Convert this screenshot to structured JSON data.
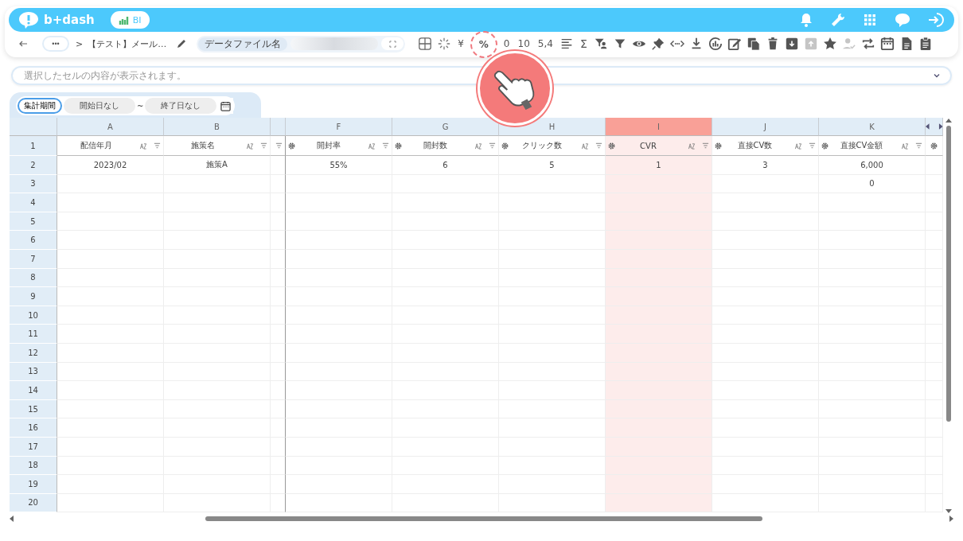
{
  "header": {
    "logo": "b+dash",
    "badge": "BI"
  },
  "breadcrumb": {
    "more": "•••",
    "separator": ">",
    "title": "【テスト】メール…"
  },
  "file_name": {
    "label": "データファイル名"
  },
  "toolbar": {
    "format_buttons": [
      {
        "label": "¥",
        "highlighted": false
      },
      {
        "label": "%",
        "highlighted": true
      },
      {
        "label": "0",
        "highlighted": false
      },
      {
        "label": "10",
        "highlighted": false
      },
      {
        "label": "5,4",
        "highlighted": false
      }
    ],
    "sum_button": "Σ",
    "tools": [
      {
        "disabled": false
      },
      {
        "disabled": false
      },
      {
        "disabled": false
      },
      {
        "disabled": false
      },
      {
        "disabled": false
      },
      {
        "disabled": false
      },
      {
        "disabled": false
      },
      {
        "disabled": false
      },
      {
        "disabled": false
      },
      {
        "disabled": false
      },
      {
        "disabled": false
      },
      {
        "disabled": true
      },
      {
        "disabled": false
      },
      {
        "disabled": true
      },
      {
        "disabled": false
      },
      {
        "disabled": false
      },
      {
        "disabled": false
      },
      {
        "disabled": false
      }
    ]
  },
  "formula_bar": {
    "placeholder": "選択したセルの内容が表示されます。"
  },
  "period": {
    "label": "集計期間",
    "start": "開始日なし",
    "separator": "~",
    "end": "終了日なし"
  },
  "grid": {
    "header_row_number": "1",
    "columns": [
      {
        "letter": "A",
        "header": "配信年月",
        "kind": "data",
        "settings": false,
        "selected": false
      },
      {
        "letter": "B",
        "header": "施策名",
        "kind": "data",
        "settings": false,
        "selected": false
      },
      {
        "kind": "narrow"
      },
      {
        "letter": "F",
        "header": "開封率",
        "kind": "data",
        "settings": true,
        "selected": false
      },
      {
        "letter": "G",
        "header": "開封数",
        "kind": "data",
        "settings": true,
        "selected": false
      },
      {
        "letter": "H",
        "header": "クリック数",
        "kind": "data",
        "settings": true,
        "selected": false
      },
      {
        "letter": "I",
        "header": "CVR",
        "kind": "data",
        "settings": true,
        "selected": true
      },
      {
        "letter": "J",
        "header": "直接CV数",
        "kind": "data",
        "settings": true,
        "selected": false
      },
      {
        "letter": "K",
        "header": "直接CV金額",
        "kind": "data",
        "settings": true,
        "selected": false
      }
    ],
    "rows": [
      {
        "number": "2",
        "cells": [
          "2023/02",
          "施策A",
          null,
          "55%",
          "6",
          "5",
          "1",
          "3",
          "6,000"
        ]
      },
      {
        "number": "3",
        "cells": [
          null,
          null,
          null,
          null,
          null,
          null,
          null,
          null,
          "0"
        ]
      },
      {
        "number": "4"
      },
      {
        "number": "5"
      },
      {
        "number": "6"
      },
      {
        "number": "7"
      },
      {
        "number": "8"
      },
      {
        "number": "9"
      },
      {
        "number": "10"
      },
      {
        "number": "11"
      },
      {
        "number": "12"
      },
      {
        "number": "13"
      },
      {
        "number": "14"
      },
      {
        "number": "15"
      },
      {
        "number": "16"
      },
      {
        "number": "17"
      },
      {
        "number": "18"
      },
      {
        "number": "19"
      },
      {
        "number": "20"
      }
    ]
  }
}
